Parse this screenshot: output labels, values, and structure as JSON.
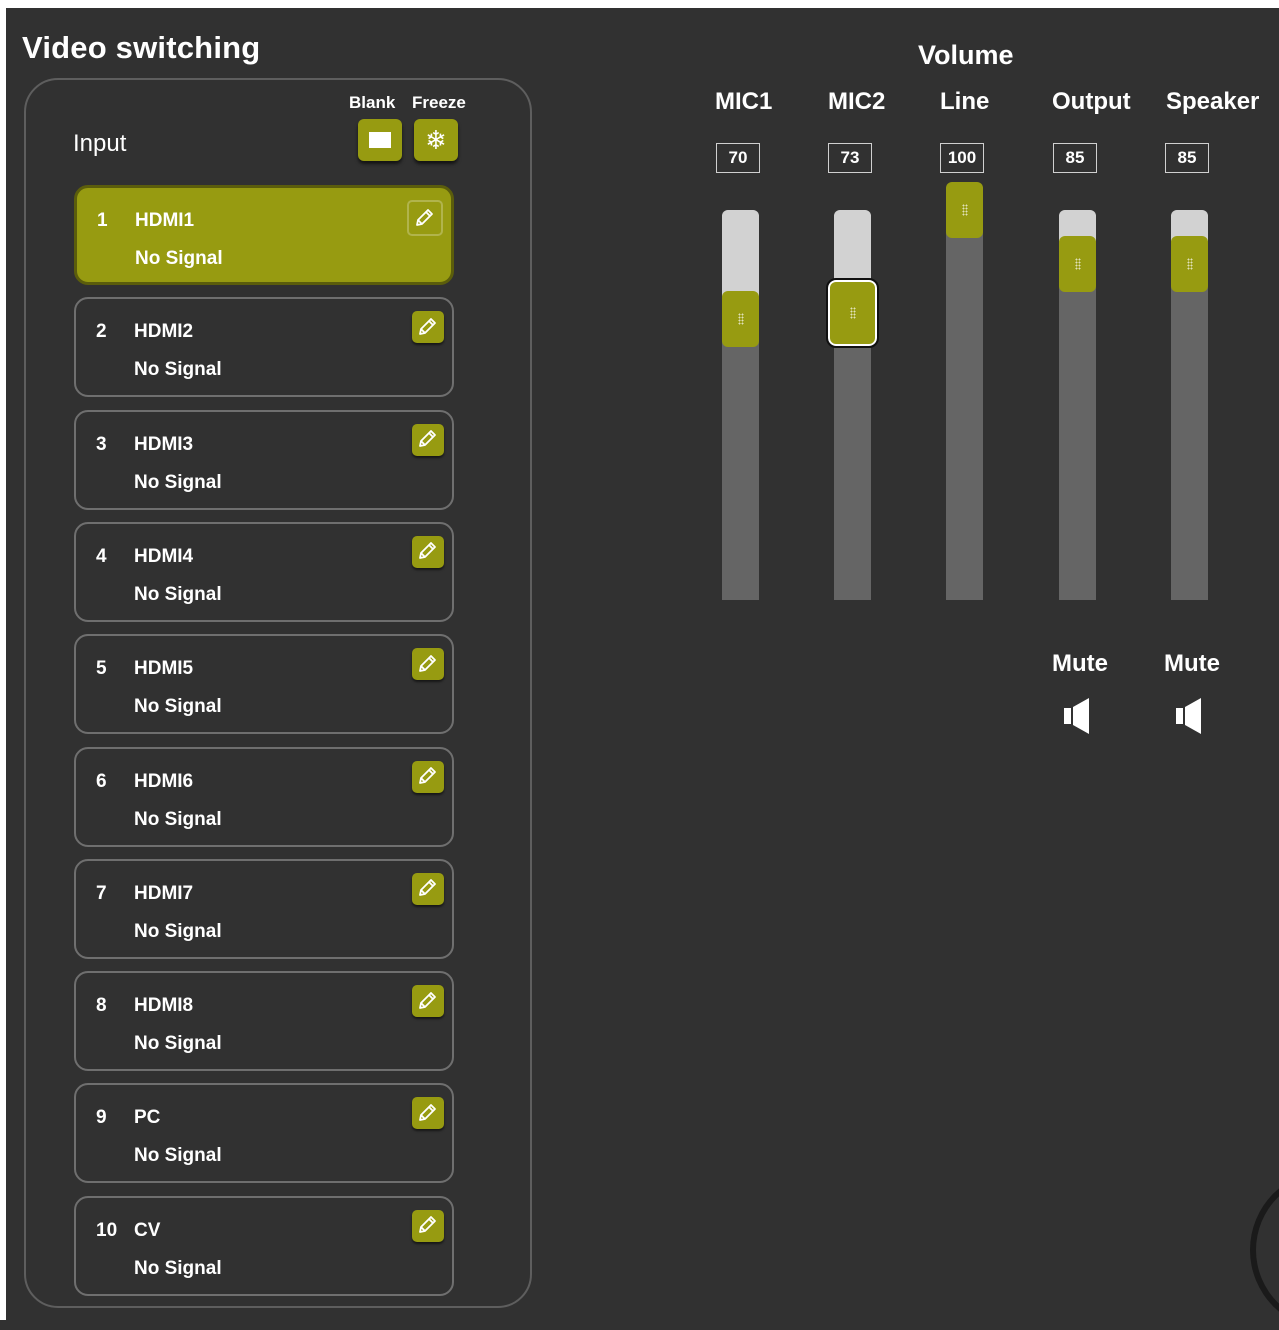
{
  "video_switching": {
    "title": "Video switching",
    "input_label": "Input",
    "blank_label": "Blank",
    "freeze_label": "Freeze",
    "edit_icon": "pencil-icon",
    "inputs": [
      {
        "num": "1",
        "name": "HDMI1",
        "status": "No Signal",
        "active": true
      },
      {
        "num": "2",
        "name": "HDMI2",
        "status": "No Signal",
        "active": false
      },
      {
        "num": "3",
        "name": "HDMI3",
        "status": "No Signal",
        "active": false
      },
      {
        "num": "4",
        "name": "HDMI4",
        "status": "No Signal",
        "active": false
      },
      {
        "num": "5",
        "name": "HDMI5",
        "status": "No Signal",
        "active": false
      },
      {
        "num": "6",
        "name": "HDMI6",
        "status": "No Signal",
        "active": false
      },
      {
        "num": "7",
        "name": "HDMI7",
        "status": "No Signal",
        "active": false
      },
      {
        "num": "8",
        "name": "HDMI8",
        "status": "No Signal",
        "active": false
      },
      {
        "num": "9",
        "name": "PC",
        "status": "No Signal",
        "active": false
      },
      {
        "num": "10",
        "name": "CV",
        "status": "No Signal",
        "active": false
      }
    ]
  },
  "volume": {
    "title": "Volume",
    "max": 100,
    "channels": [
      {
        "label": "MIC1",
        "value": "70",
        "level": 70,
        "focused": false
      },
      {
        "label": "MIC2",
        "value": "73",
        "level": 73,
        "focused": true
      },
      {
        "label": "Line",
        "value": "100",
        "level": 100,
        "focused": false
      },
      {
        "label": "Output",
        "value": "85",
        "level": 85,
        "focused": false
      },
      {
        "label": "Speaker",
        "value": "85",
        "level": 85,
        "focused": false
      }
    ],
    "mutes": [
      {
        "label": "Mute",
        "icon": "speaker-icon"
      },
      {
        "label": "Mute",
        "icon": "speaker-icon"
      }
    ]
  },
  "colors": {
    "accent": "#979b11",
    "background": "#313131",
    "track_empty": "#d2d2d2",
    "track_filled": "#656565"
  }
}
